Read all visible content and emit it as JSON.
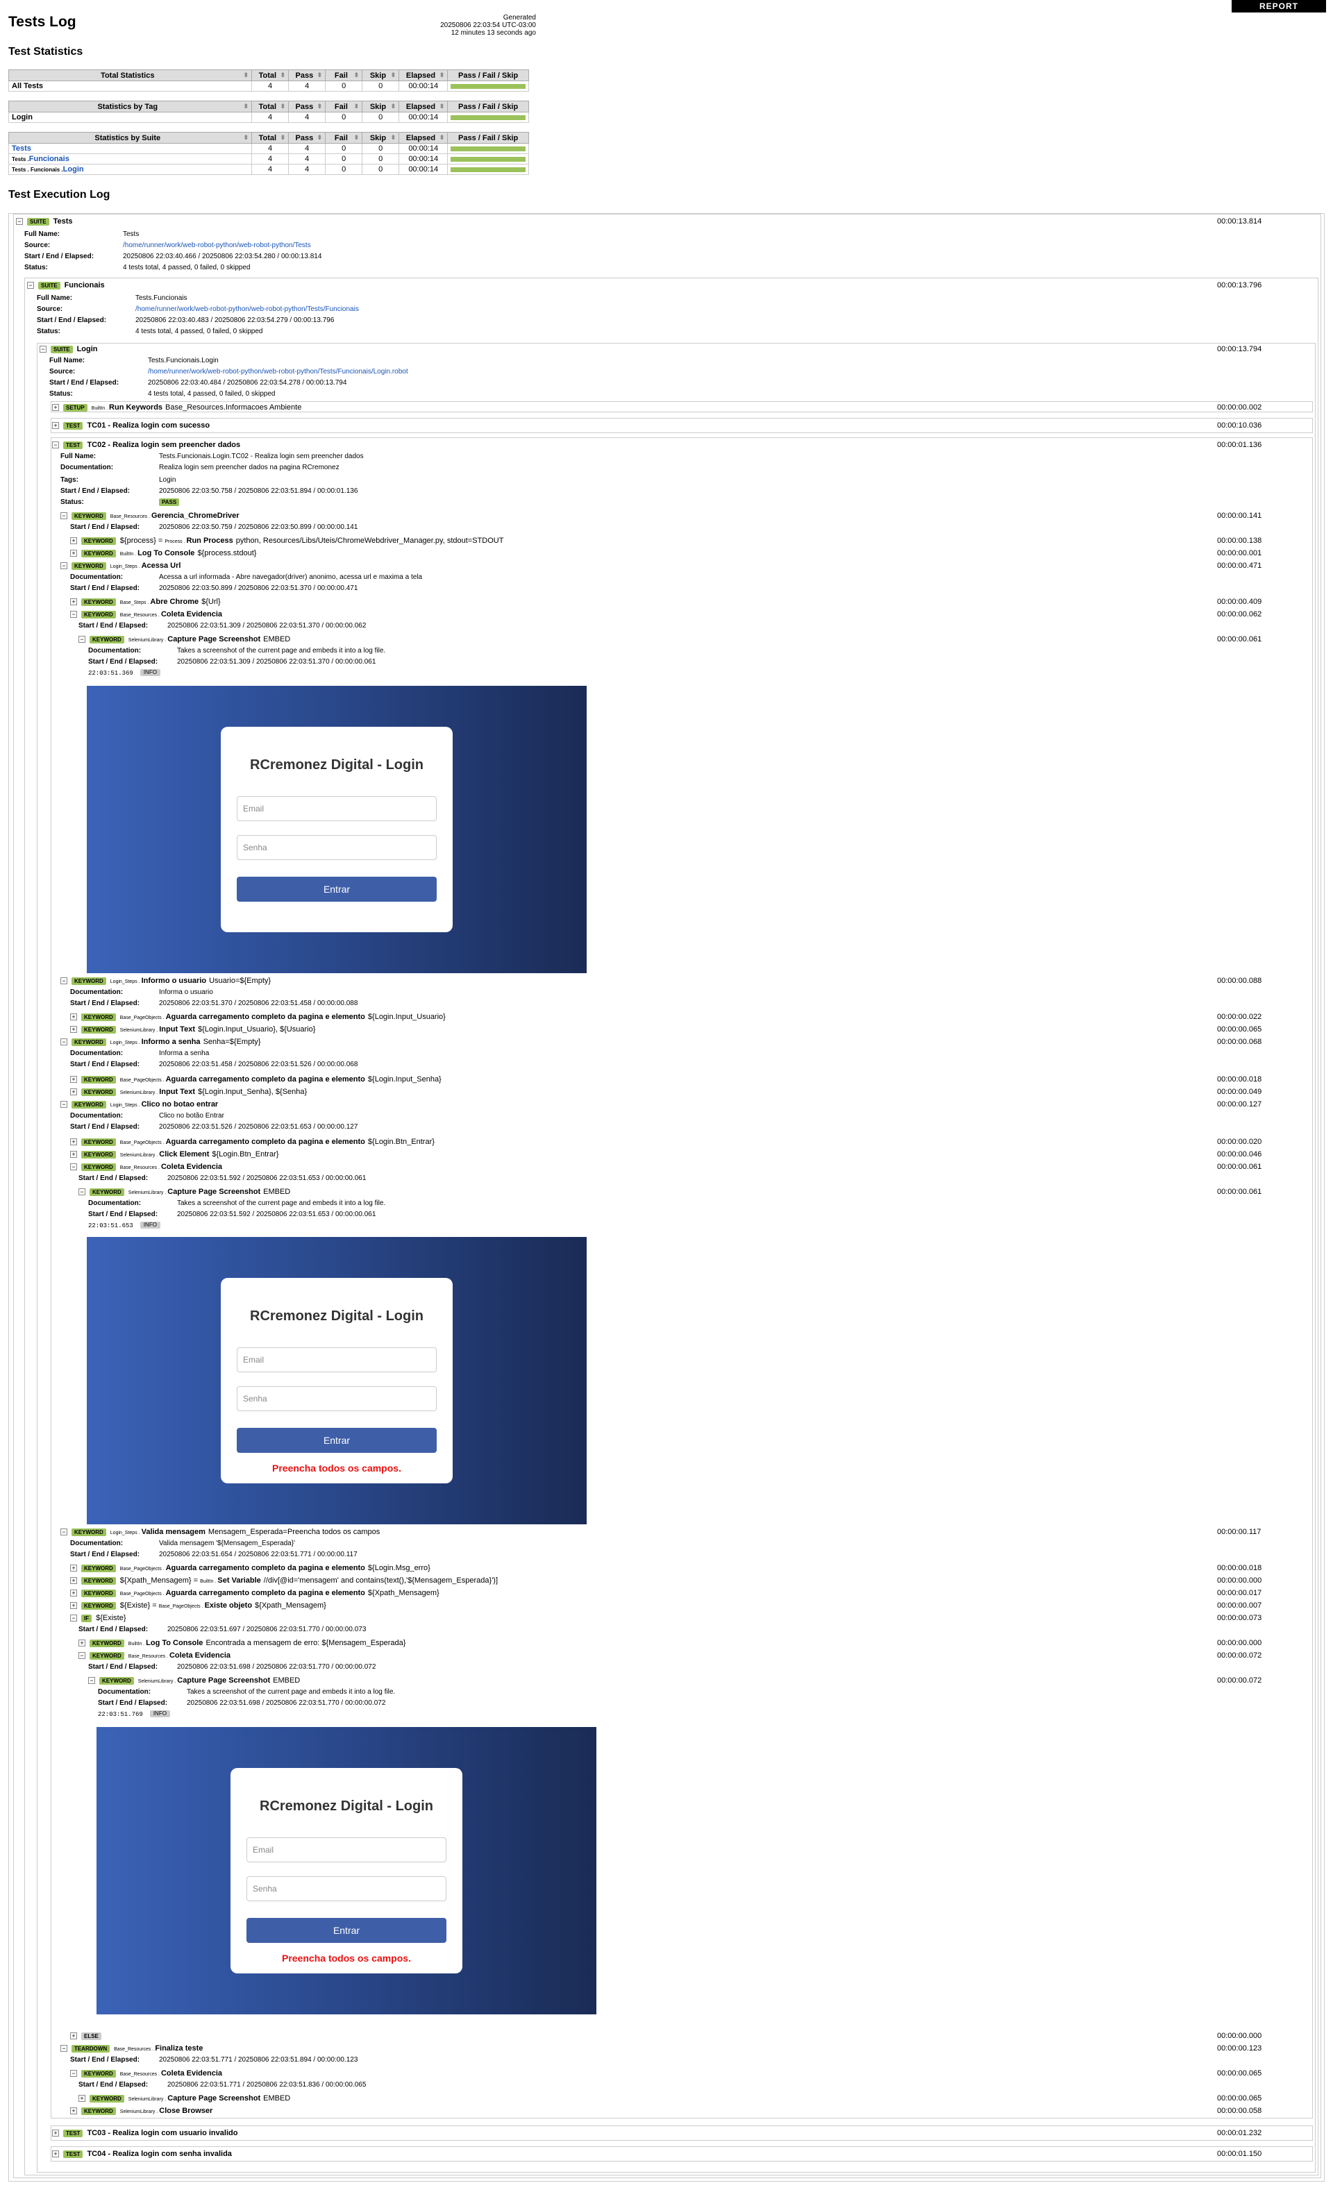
{
  "header": {
    "title": "Tests Log",
    "generated_label": "Generated",
    "generated_time": "20250806 22:03:54 UTC-03:00",
    "generated_ago": "12 minutes 13 seconds ago",
    "report_button": "REPORT"
  },
  "statistics": {
    "heading": "Test Statistics",
    "columns": [
      "Total",
      "Pass",
      "Fail",
      "Skip",
      "Elapsed",
      "Pass / Fail / Skip"
    ],
    "total": {
      "title": "Total Statistics",
      "rows": [
        {
          "name": "All Tests",
          "total": "4",
          "pass": "4",
          "fail": "0",
          "skip": "0",
          "elapsed": "00:00:14"
        }
      ]
    },
    "tag": {
      "title": "Statistics by Tag",
      "rows": [
        {
          "name": "Login",
          "total": "4",
          "pass": "4",
          "fail": "0",
          "skip": "0",
          "elapsed": "00:00:14"
        }
      ]
    },
    "suite": {
      "title": "Statistics by Suite",
      "rows": [
        {
          "prefix": "",
          "name": "Tests",
          "total": "4",
          "pass": "4",
          "fail": "0",
          "skip": "0",
          "elapsed": "00:00:14"
        },
        {
          "prefix": "Tests .",
          "name": "Funcionais",
          "total": "4",
          "pass": "4",
          "fail": "0",
          "skip": "0",
          "elapsed": "00:00:14"
        },
        {
          "prefix": "Tests . Funcionais .",
          "name": "Login",
          "total": "4",
          "pass": "4",
          "fail": "0",
          "skip": "0",
          "elapsed": "00:00:14"
        }
      ]
    }
  },
  "log": {
    "heading": "Test Execution Log",
    "labels": {
      "full_name": "Full Name:",
      "source": "Source:",
      "start_end": "Start / End / Elapsed:",
      "status": "Status:",
      "documentation": "Documentation:",
      "tags": "Tags:"
    },
    "suite_tests": {
      "badge": "SUITE",
      "name": "Tests",
      "elapsed": "00:00:13.814",
      "full_name": "Tests",
      "source": "/home/runner/work/web-robot-python/web-robot-python/Tests",
      "start_end": "20250806 22:03:40.466 / 20250806 22:03:54.280 / 00:00:13.814",
      "status": "4 tests total, 4 passed, 0 failed, 0 skipped"
    },
    "suite_funcionais": {
      "badge": "SUITE",
      "name": "Funcionais",
      "elapsed": "00:00:13.796",
      "full_name": "Tests.Funcionais",
      "source": "/home/runner/work/web-robot-python/web-robot-python/Tests/Funcionais",
      "start_end": "20250806 22:03:40.483 / 20250806 22:03:54.279 / 00:00:13.796",
      "status": "4 tests total, 4 passed, 0 failed, 0 skipped"
    },
    "suite_login": {
      "badge": "SUITE",
      "name": "Login",
      "elapsed": "00:00:13.794",
      "full_name": "Tests.Funcionais.Login",
      "source": "/home/runner/work/web-robot-python/web-robot-python/Tests/Funcionais/Login.robot",
      "start_end": "20250806 22:03:40.484 / 20250806 22:03:54.278 / 00:00:13.794",
      "status": "4 tests total, 4 passed, 0 failed, 0 skipped"
    },
    "setup": {
      "badge": "SETUP",
      "lib": "BuiltIn .",
      "name": "Run Keywords",
      "args": "Base_Resources.Informacoes Ambiente",
      "elapsed": "00:00:00.002"
    },
    "tc01": {
      "badge": "TEST",
      "name": "TC01 - Realiza login com sucesso",
      "elapsed": "00:00:10.036"
    },
    "tc02": {
      "badge": "TEST",
      "name": "TC02 - Realiza login sem preencher dados",
      "elapsed": "00:00:01.136",
      "full_name": "Tests.Funcionais.Login.TC02 - Realiza login sem preencher dados",
      "documentation": "Realiza login sem preencher dados na pagina RCremonez",
      "tags": "Login",
      "start_end": "20250806 22:03:50.758 / 20250806 22:03:51.894 / 00:00:01.136",
      "status": "PASS"
    },
    "tc03": {
      "badge": "TEST",
      "name": "TC03 - Realiza login com usuario invalido",
      "elapsed": "00:00:01.232"
    },
    "tc04": {
      "badge": "TEST",
      "name": "TC04 - Realiza login com senha invalida",
      "elapsed": "00:00:01.150"
    },
    "kw": [
      {
        "id": "k1",
        "badge": "KEYWORD",
        "lib": "Base_Resources .",
        "name": "Gerencia_ChromeDriver",
        "args": "",
        "elapsed": "00:00:00.141",
        "start_end": "20250806 22:03:50.759 / 20250806 22:03:50.899 / 00:00:00.141"
      },
      {
        "id": "k2",
        "badge": "KEYWORD",
        "pre": "${process} = ",
        "lib": "Process .",
        "name": "Run Process",
        "args": "python, Resources/Libs/Uteis/ChromeWebdriver_Manager.py, stdout=STDOUT",
        "elapsed": "00:00:00.138"
      },
      {
        "id": "k3",
        "badge": "KEYWORD",
        "lib": "BuiltIn .",
        "name": "Log To Console",
        "args": "${process.stdout}",
        "elapsed": "00:00:00.001"
      },
      {
        "id": "k4",
        "badge": "KEYWORD",
        "lib": "Login_Steps .",
        "name": "Acessa Url",
        "args": "",
        "elapsed": "00:00:00.471",
        "documentation": "Acessa a url informada - Abre navegador(driver) anonimo, acessa url e maxima a tela",
        "start_end": "20250806 22:03:50.899 / 20250806 22:03:51.370 / 00:00:00.471"
      },
      {
        "id": "k5",
        "badge": "KEYWORD",
        "lib": "Base_Steps .",
        "name": "Abre Chrome",
        "args": "${Url}",
        "elapsed": "00:00:00.409"
      },
      {
        "id": "k6",
        "badge": "KEYWORD",
        "lib": "Base_Resources .",
        "name": "Coleta Evidencia",
        "args": "",
        "elapsed": "00:00:00.062",
        "start_end": "20250806 22:03:51.309 / 20250806 22:03:51.370 / 00:00:00.062"
      },
      {
        "id": "k7",
        "badge": "KEYWORD",
        "lib": "SeleniumLibrary .",
        "name": "Capture Page Screenshot",
        "args": "EMBED",
        "elapsed": "00:00:00.061",
        "documentation": "Takes a screenshot of the current page and embeds it into a log file.",
        "start_end": "20250806 22:03:51.309 / 20250806 22:03:51.370 / 00:00:00.061",
        "log_time": "22:03:51.369",
        "log_level": "INFO"
      },
      {
        "id": "k8",
        "badge": "KEYWORD",
        "lib": "Login_Steps .",
        "name": "Informo o usuario",
        "args": "Usuario=${Empty}",
        "elapsed": "00:00:00.088",
        "documentation": "Informa o usuario",
        "start_end": "20250806 22:03:51.370 / 20250806 22:03:51.458 / 00:00:00.088"
      },
      {
        "id": "k9",
        "badge": "KEYWORD",
        "lib": "Base_PageObjects .",
        "name": "Aguarda carregamento completo da pagina e elemento",
        "args": "${Login.Input_Usuario}",
        "elapsed": "00:00:00.022"
      },
      {
        "id": "k10",
        "badge": "KEYWORD",
        "lib": "SeleniumLibrary .",
        "name": "Input Text",
        "args": "${Login.Input_Usuario}, ${Usuario}",
        "elapsed": "00:00:00.065"
      },
      {
        "id": "k11",
        "badge": "KEYWORD",
        "lib": "Login_Steps .",
        "name": "Informo a senha",
        "args": "Senha=${Empty}",
        "elapsed": "00:00:00.068",
        "documentation": "Informa a senha",
        "start_end": "20250806 22:03:51.458 / 20250806 22:03:51.526 / 00:00:00.068"
      },
      {
        "id": "k12",
        "badge": "KEYWORD",
        "lib": "Base_PageObjects .",
        "name": "Aguarda carregamento completo da pagina e elemento",
        "args": "${Login.Input_Senha}",
        "elapsed": "00:00:00.018"
      },
      {
        "id": "k13",
        "badge": "KEYWORD",
        "lib": "SeleniumLibrary .",
        "name": "Input Text",
        "args": "${Login.Input_Senha}, ${Senha}",
        "elapsed": "00:00:00.049"
      },
      {
        "id": "k14",
        "badge": "KEYWORD",
        "lib": "Login_Steps .",
        "name": "Clico no botao entrar",
        "args": "",
        "elapsed": "00:00:00.127",
        "documentation": "Clico no botão Entrar",
        "start_end": "20250806 22:03:51.526 / 20250806 22:03:51.653 / 00:00:00.127"
      },
      {
        "id": "k15",
        "badge": "KEYWORD",
        "lib": "Base_PageObjects .",
        "name": "Aguarda carregamento completo da pagina e elemento",
        "args": "${Login.Btn_Entrar}",
        "elapsed": "00:00:00.020"
      },
      {
        "id": "k16",
        "badge": "KEYWORD",
        "lib": "SeleniumLibrary .",
        "name": "Click Element",
        "args": "${Login.Btn_Entrar}",
        "elapsed": "00:00:00.046"
      },
      {
        "id": "k17",
        "badge": "KEYWORD",
        "lib": "Base_Resources .",
        "name": "Coleta Evidencia",
        "args": "",
        "elapsed": "00:00:00.061",
        "start_end": "20250806 22:03:51.592 / 20250806 22:03:51.653 / 00:00:00.061"
      },
      {
        "id": "k18",
        "badge": "KEYWORD",
        "lib": "SeleniumLibrary .",
        "name": "Capture Page Screenshot",
        "args": "EMBED",
        "elapsed": "00:00:00.061",
        "documentation": "Takes a screenshot of the current page and embeds it into a log file.",
        "start_end": "20250806 22:03:51.592 / 20250806 22:03:51.653 / 00:00:00.061",
        "log_time": "22:03:51.653",
        "log_level": "INFO"
      },
      {
        "id": "k19",
        "badge": "KEYWORD",
        "lib": "Login_Steps .",
        "name": "Valida mensagem",
        "args": "Mensagem_Esperada=Preencha todos os campos",
        "elapsed": "00:00:00.117",
        "documentation": "Valida mensagem '${Mensagem_Esperada}'",
        "start_end": "20250806 22:03:51.654 / 20250806 22:03:51.771 / 00:00:00.117"
      },
      {
        "id": "k20",
        "badge": "KEYWORD",
        "lib": "Base_PageObjects .",
        "name": "Aguarda carregamento completo da pagina e elemento",
        "args": "${Login.Msg_erro}",
        "elapsed": "00:00:00.018"
      },
      {
        "id": "k21",
        "badge": "KEYWORD",
        "pre": "${Xpath_Mensagem} = ",
        "lib": "BuiltIn .",
        "name": "Set Variable",
        "args": "//div[@id='mensagem' and contains(text(),'${Mensagem_Esperada}')]",
        "elapsed": "00:00:00.000"
      },
      {
        "id": "k22",
        "badge": "KEYWORD",
        "lib": "Base_PageObjects .",
        "name": "Aguarda carregamento completo da pagina e elemento",
        "args": "${Xpath_Mensagem}",
        "elapsed": "00:00:00.017"
      },
      {
        "id": "k23",
        "badge": "KEYWORD",
        "pre": "${Existe} = ",
        "lib": "Base_PageObjects .",
        "name": "Existe objeto",
        "args": "${Xpath_Mensagem}",
        "elapsed": "00:00:00.007"
      },
      {
        "id": "k24",
        "badge": "IF",
        "lib": "",
        "name": "",
        "args": "${Existe}",
        "elapsed": "00:00:00.073",
        "start_end": "20250806 22:03:51.697 / 20250806 22:03:51.770 / 00:00:00.073"
      },
      {
        "id": "k25",
        "badge": "KEYWORD",
        "lib": "BuiltIn .",
        "name": "Log To Console",
        "args": "Encontrada a mensagem de erro: ${Mensagem_Esperada}",
        "elapsed": "00:00:00.000"
      },
      {
        "id": "k26",
        "badge": "KEYWORD",
        "lib": "Base_Resources .",
        "name": "Coleta Evidencia",
        "args": "",
        "elapsed": "00:00:00.072",
        "start_end": "20250806 22:03:51.698 / 20250806 22:03:51.770 / 00:00:00.072"
      },
      {
        "id": "k27",
        "badge": "KEYWORD",
        "lib": "SeleniumLibrary .",
        "name": "Capture Page Screenshot",
        "args": "EMBED",
        "elapsed": "00:00:00.072",
        "documentation": "Takes a screenshot of the current page and embeds it into a log file.",
        "start_end": "20250806 22:03:51.698 / 20250806 22:03:51.770 / 00:00:00.072",
        "log_time": "22:03:51.769",
        "log_level": "INFO"
      },
      {
        "id": "k28",
        "badge": "ELSE",
        "lib": "",
        "name": "",
        "args": "",
        "elapsed": "00:00:00.000"
      },
      {
        "id": "k29",
        "badge": "TEARDOWN",
        "lib": "Base_Resources .",
        "name": "Finaliza teste",
        "args": "",
        "elapsed": "00:00:00.123",
        "start_end": "20250806 22:03:51.771 / 20250806 22:03:51.894 / 00:00:00.123"
      },
      {
        "id": "k30",
        "badge": "KEYWORD",
        "lib": "Base_Resources .",
        "name": "Coleta Evidencia",
        "args": "",
        "elapsed": "00:00:00.065",
        "start_end": "20250806 22:03:51.771 / 20250806 22:03:51.836 / 00:00:00.065"
      },
      {
        "id": "k31",
        "badge": "KEYWORD",
        "lib": "SeleniumLibrary .",
        "name": "Capture Page Screenshot",
        "args": "EMBED",
        "elapsed": "00:00:00.065"
      },
      {
        "id": "k32",
        "badge": "KEYWORD",
        "lib": "SeleniumLibrary .",
        "name": "Close Browser",
        "args": "",
        "elapsed": "00:00:00.058"
      }
    ],
    "screenshot": {
      "title": "RCremonez Digital - Login",
      "email_placeholder": "Email",
      "senha_placeholder": "Senha",
      "button": "Entrar",
      "error": "Preencha todos os campos."
    }
  }
}
